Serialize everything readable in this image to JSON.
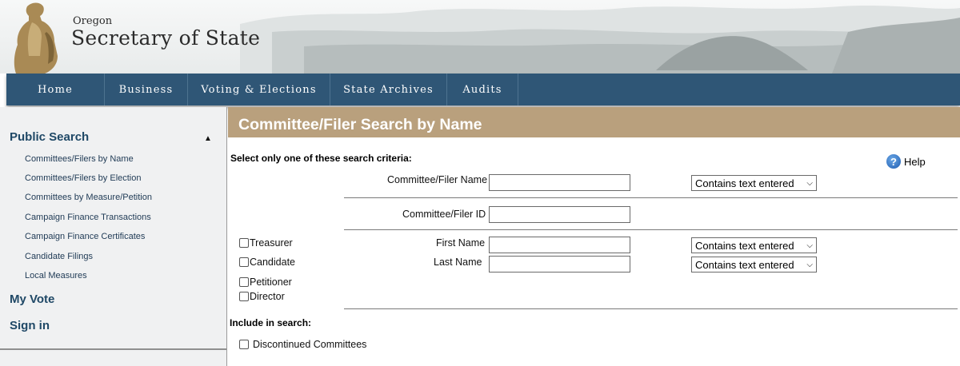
{
  "header": {
    "brand_small": "Oregon",
    "brand_large": "Secretary of State"
  },
  "nav": {
    "items": [
      "Home",
      "Business",
      "Voting & Elections",
      "State Archives",
      "Audits"
    ]
  },
  "sidebar": {
    "heading": "Public Search",
    "collapse_icon": "▲",
    "links": [
      "Committees/Filers by Name",
      "Committees/Filers by Election",
      "Committees by Measure/Petition",
      "Campaign Finance Transactions",
      "Campaign Finance Certificates",
      "Candidate Filings",
      "Local Measures"
    ],
    "my_vote": "My Vote",
    "sign_in": "Sign in"
  },
  "main": {
    "title": "Committee/Filer Search by Name",
    "instructions": "Select only one of these search criteria:",
    "help_label": "Help",
    "help_icon": "?",
    "committee_name_label": "Committee/Filer Name",
    "committee_name_value": "",
    "committee_name_mode": "Contains text entered",
    "committee_id_label": "Committee/Filer ID",
    "committee_id_value": "",
    "role_checkboxes": [
      "Treasurer",
      "Candidate",
      "Petitioner",
      "Director"
    ],
    "first_name_label": "First Name",
    "first_name_value": "",
    "first_name_mode": "Contains text entered",
    "last_name_label": "Last Name",
    "last_name_value": "",
    "last_name_mode": "Contains text entered",
    "include_label": "Include in search:",
    "discontinued_label": "Discontinued Committees"
  }
}
